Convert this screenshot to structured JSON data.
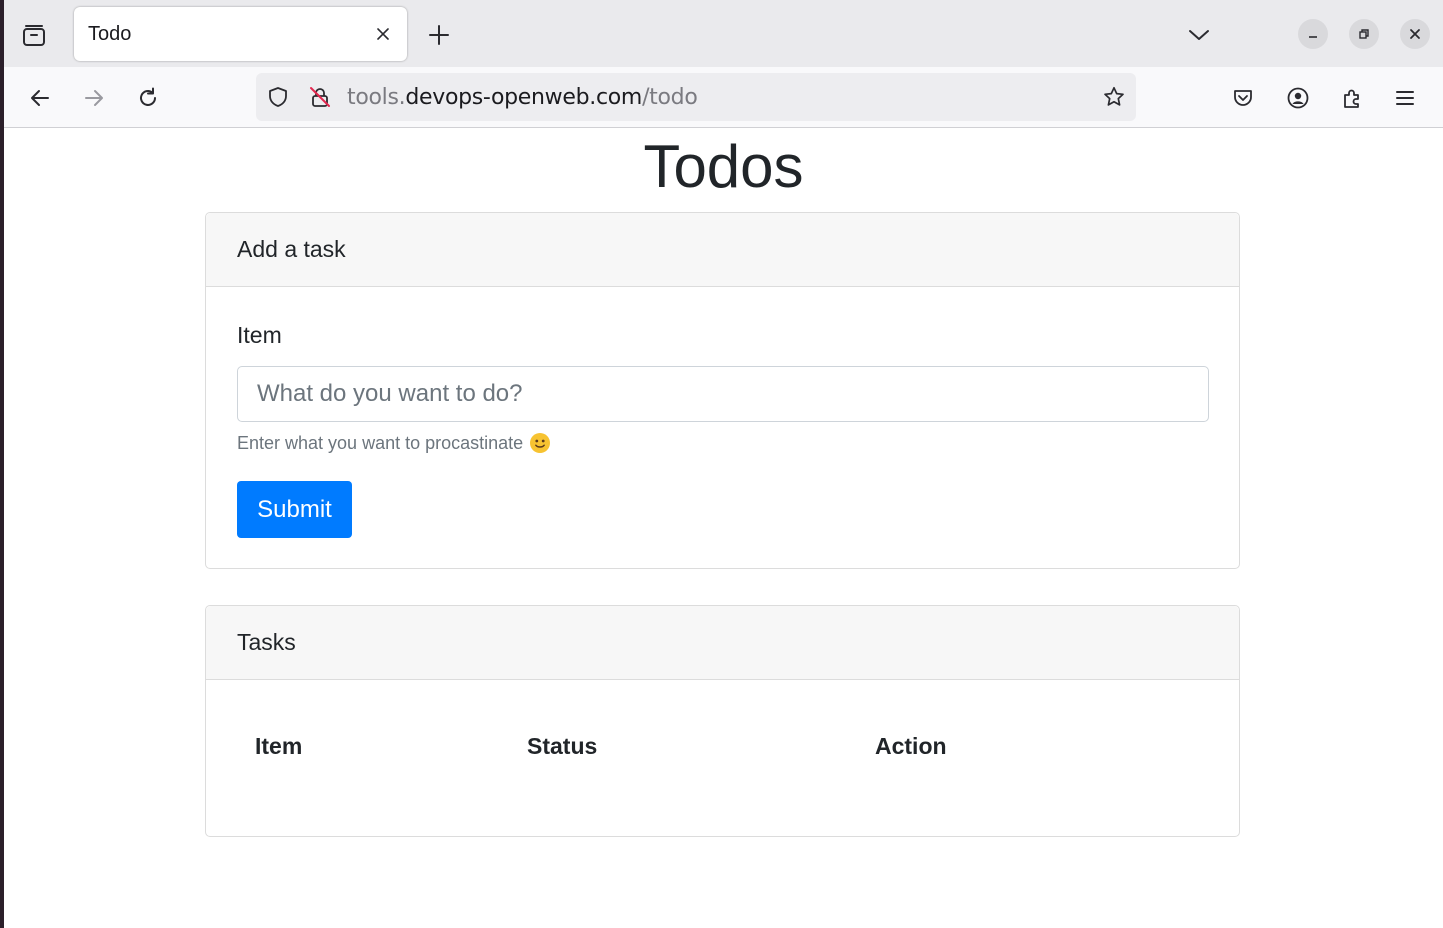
{
  "browser": {
    "tab": {
      "title": "Todo"
    },
    "url": {
      "prefix": "tools.",
      "domain": "devops-openweb.com",
      "path": "/todo"
    }
  },
  "page": {
    "title": "Todos",
    "add_card": {
      "header": "Add a task",
      "item_label": "Item",
      "input_placeholder": "What do you want to do?",
      "input_value": "",
      "help_text": "Enter what you want to procastinate",
      "submit_label": "Submit"
    },
    "tasks_card": {
      "header": "Tasks",
      "columns": [
        "Item",
        "Status",
        "Action"
      ],
      "rows": []
    }
  },
  "colors": {
    "primary_button": "#007bff",
    "card_header_bg": "#f7f7f7",
    "text": "#212529",
    "muted_text": "#6c757d"
  },
  "icons": [
    "tab-overview-icon",
    "close-icon",
    "plus-icon",
    "chevron-down-icon",
    "minimize-icon",
    "restore-icon",
    "back-arrow-icon",
    "forward-arrow-icon",
    "reload-icon",
    "shield-icon",
    "insecure-lock-icon",
    "star-icon",
    "pocket-icon",
    "account-icon",
    "extensions-icon",
    "hamburger-menu-icon",
    "smiley-emoji-icon"
  ]
}
